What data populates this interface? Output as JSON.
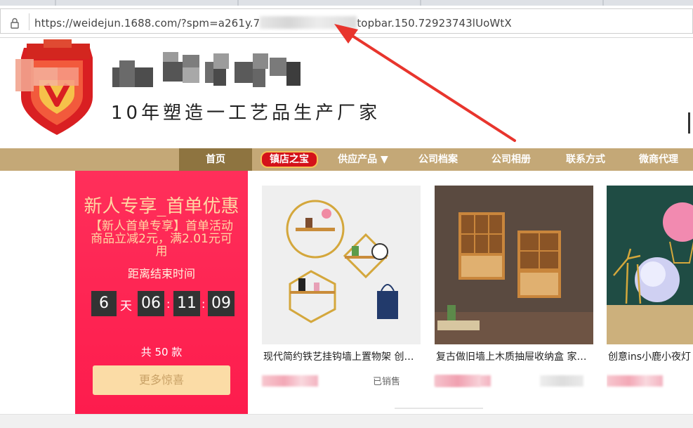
{
  "browser": {
    "url_prefix": "https://weidejun.1688.com/?spm=a261y.7",
    "url_suffix": "topbar.150.72923743lUoWtX"
  },
  "header": {
    "slogan": "10年塑造一工艺品生产厂家"
  },
  "nav": {
    "home": "首页",
    "treasure": "镇店之宝",
    "products": "供应产品 ▼",
    "archive": "公司档案",
    "album": "公司相册",
    "contact": "联系方式",
    "agent": "微商代理"
  },
  "promo": {
    "title": "新人专享_首单优惠",
    "description": "【新人首单专享】首单活动商品立减2元，满2.01元可用",
    "countdown_label": "距离结束时间",
    "countdown": {
      "days": "6",
      "day_unit": "天",
      "hours": "06",
      "minutes": "11",
      "seconds": "09"
    },
    "count_text": "共 50 款",
    "more_button": "更多惊喜"
  },
  "products": [
    {
      "title": "现代简约铁艺挂钩墙上置物架 创意墙面装饰"
    },
    {
      "title": "复古做旧墙上木质抽屉收纳盒 家居装饰"
    },
    {
      "title": "创意ins小鹿小夜灯"
    }
  ],
  "product_sales_fragment": "已销售",
  "colors": {
    "nav_bg": "#c4a877",
    "nav_active": "#8e7440",
    "promo_bg": "#fd1c4d",
    "promo_text": "#ffd7a3",
    "arrow": "#e8352d"
  }
}
